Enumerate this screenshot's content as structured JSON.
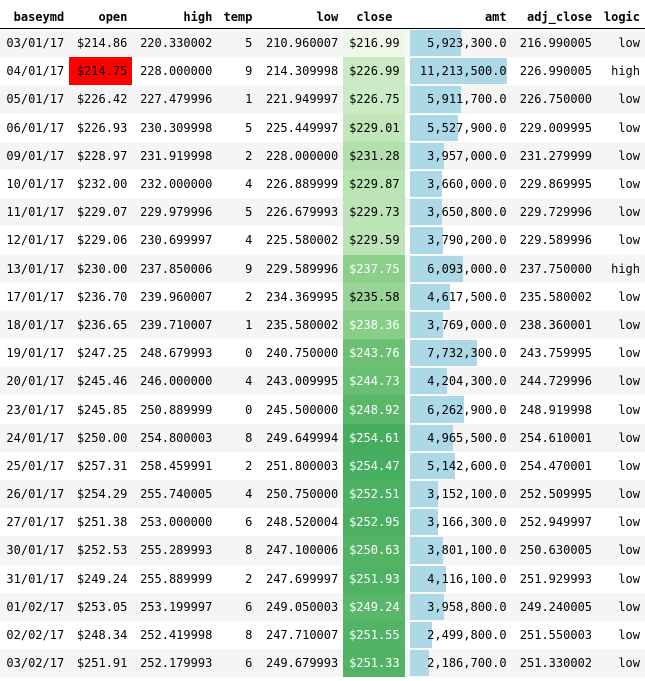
{
  "columns": [
    "baseymd",
    "open",
    "high",
    "temp",
    "low",
    "close",
    "amt",
    "adj_close",
    "logic"
  ],
  "colors": {
    "highlight_max": "#ff0000",
    "bar": "#add8e6",
    "close_gradient_light": "#f7fcf5",
    "close_gradient_dark": "#00441b"
  },
  "close_range": [
    214.0,
    256.0
  ],
  "amt_max": 11213500,
  "highlight": {
    "column": "open",
    "row": 1
  },
  "rows": [
    [
      "03/01/17",
      "$214.86",
      "220.330002",
      "5",
      "210.960007",
      "$216.99",
      "5,923,300.0",
      "216.990005",
      "low"
    ],
    [
      "04/01/17",
      "$214.75",
      "228.000000",
      "9",
      "214.309998",
      "$226.99",
      "11,213,500.0",
      "226.990005",
      "high"
    ],
    [
      "05/01/17",
      "$226.42",
      "227.479996",
      "1",
      "221.949997",
      "$226.75",
      "5,911,700.0",
      "226.750000",
      "low"
    ],
    [
      "06/01/17",
      "$226.93",
      "230.309998",
      "5",
      "225.449997",
      "$229.01",
      "5,527,900.0",
      "229.009995",
      "low"
    ],
    [
      "09/01/17",
      "$228.97",
      "231.919998",
      "2",
      "228.000000",
      "$231.28",
      "3,957,000.0",
      "231.279999",
      "low"
    ],
    [
      "10/01/17",
      "$232.00",
      "232.000000",
      "4",
      "226.889999",
      "$229.87",
      "3,660,000.0",
      "229.869995",
      "low"
    ],
    [
      "11/01/17",
      "$229.07",
      "229.979996",
      "5",
      "226.679993",
      "$229.73",
      "3,650,800.0",
      "229.729996",
      "low"
    ],
    [
      "12/01/17",
      "$229.06",
      "230.699997",
      "4",
      "225.580002",
      "$229.59",
      "3,790,200.0",
      "229.589996",
      "low"
    ],
    [
      "13/01/17",
      "$230.00",
      "237.850006",
      "9",
      "229.589996",
      "$237.75",
      "6,093,000.0",
      "237.750000",
      "high"
    ],
    [
      "17/01/17",
      "$236.70",
      "239.960007",
      "2",
      "234.369995",
      "$235.58",
      "4,617,500.0",
      "235.580002",
      "low"
    ],
    [
      "18/01/17",
      "$236.65",
      "239.710007",
      "1",
      "235.580002",
      "$238.36",
      "3,769,000.0",
      "238.360001",
      "low"
    ],
    [
      "19/01/17",
      "$247.25",
      "248.679993",
      "0",
      "240.750000",
      "$243.76",
      "7,732,300.0",
      "243.759995",
      "low"
    ],
    [
      "20/01/17",
      "$245.46",
      "246.000000",
      "4",
      "243.009995",
      "$244.73",
      "4,204,300.0",
      "244.729996",
      "low"
    ],
    [
      "23/01/17",
      "$245.85",
      "250.889999",
      "0",
      "245.500000",
      "$248.92",
      "6,262,900.0",
      "248.919998",
      "low"
    ],
    [
      "24/01/17",
      "$250.00",
      "254.800003",
      "8",
      "249.649994",
      "$254.61",
      "4,965,500.0",
      "254.610001",
      "low"
    ],
    [
      "25/01/17",
      "$257.31",
      "258.459991",
      "2",
      "251.800003",
      "$254.47",
      "5,142,600.0",
      "254.470001",
      "low"
    ],
    [
      "26/01/17",
      "$254.29",
      "255.740005",
      "4",
      "250.750000",
      "$252.51",
      "3,152,100.0",
      "252.509995",
      "low"
    ],
    [
      "27/01/17",
      "$251.38",
      "253.000000",
      "6",
      "248.520004",
      "$252.95",
      "3,166,300.0",
      "252.949997",
      "low"
    ],
    [
      "30/01/17",
      "$252.53",
      "255.289993",
      "8",
      "247.100006",
      "$250.63",
      "3,801,100.0",
      "250.630005",
      "low"
    ],
    [
      "31/01/17",
      "$249.24",
      "255.889999",
      "2",
      "247.699997",
      "$251.93",
      "4,116,100.0",
      "251.929993",
      "low"
    ],
    [
      "01/02/17",
      "$253.05",
      "253.199997",
      "6",
      "249.050003",
      "$249.24",
      "3,958,800.0",
      "249.240005",
      "low"
    ],
    [
      "02/02/17",
      "$248.34",
      "252.419998",
      "8",
      "247.710007",
      "$251.55",
      "2,499,800.0",
      "251.550003",
      "low"
    ],
    [
      "03/02/17",
      "$251.91",
      "252.179993",
      "6",
      "249.679993",
      "$251.33",
      "2,186,700.0",
      "251.330002",
      "low"
    ]
  ]
}
